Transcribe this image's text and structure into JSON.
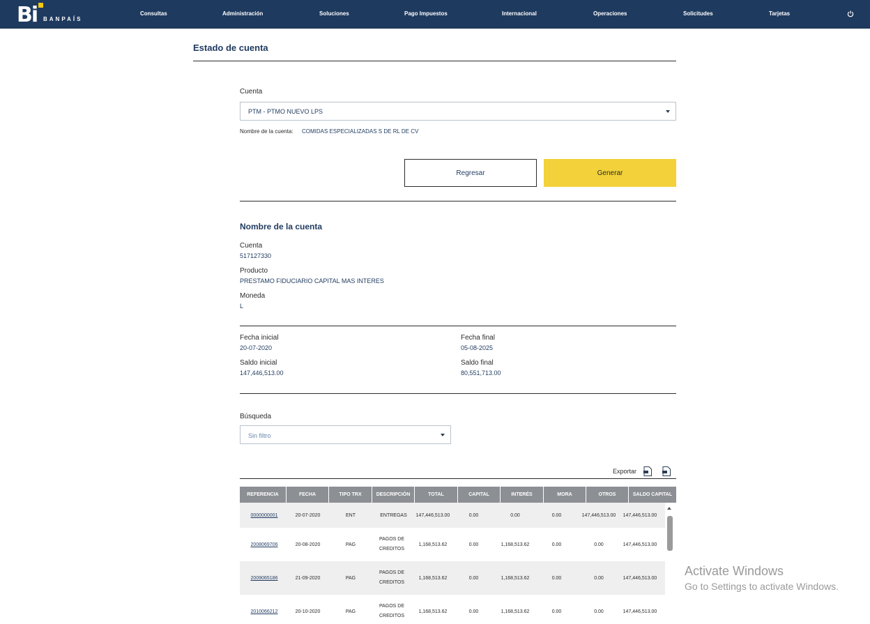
{
  "brand": {
    "logo_mark": "Bi",
    "name": "BANPAÍS"
  },
  "nav": {
    "items": [
      "Consultas",
      "Administración",
      "Soluciones",
      "Pago Impuestos",
      "Internacional",
      "Operaciones",
      "Solicitudes",
      "Tarjetas"
    ],
    "power_icon": "power-icon"
  },
  "page": {
    "title": "Estado de cuenta"
  },
  "form": {
    "cuenta_label": "Cuenta",
    "cuenta_value": "PTM - PTMO NUEVO LPS",
    "nombre_cuenta_label": "Nombre de la cuenta:",
    "nombre_cuenta_value": "COMIDAS ESPECIALIZADAS S DE RL DE CV",
    "back_label": "Regresar",
    "generate_label": "Generar"
  },
  "details": {
    "title": "Nombre de la cuenta",
    "cuenta_label": "Cuenta",
    "cuenta_value": "517127330",
    "producto_label": "Producto",
    "producto_value": "PRESTAMO FIDUCIARIO CAPITAL MAS INTERES",
    "moneda_label": "Moneda",
    "moneda_value": "L"
  },
  "period": {
    "fecha_inicial_label": "Fecha inicial",
    "fecha_inicial_value": "20-07-2020",
    "fecha_final_label": "Fecha final",
    "fecha_final_value": "05-08-2025",
    "saldo_inicial_label": "Saldo inicial",
    "saldo_inicial_value": "147,446,513.00",
    "saldo_final_label": "Saldo final",
    "saldo_final_value": "80,551,713.00"
  },
  "search": {
    "label": "Búsqueda",
    "value": "Sin filtro"
  },
  "export": {
    "label": "Exportar"
  },
  "table": {
    "headers": [
      "REFERENCIA",
      "FECHA",
      "TIPO TRX",
      "DESCRIPCIÓN",
      "TOTAL",
      "CAPITAL",
      "INTERÉS",
      "MORA",
      "OTROS",
      "SALDO CAPITAL"
    ],
    "rows": [
      [
        "0000000001",
        "20-07-2020",
        "ENT",
        "ENTREGAS",
        "147,446,513.00",
        "0.00",
        "0.00",
        "0.00",
        "147,446,513.00",
        "147,446,513.00"
      ],
      [
        "2008069706",
        "20-08-2020",
        "PAG",
        "PAGOS DE CREDITOS",
        "1,168,513.62",
        "0.00",
        "1,168,513.62",
        "0.00",
        "0.00",
        "147,446,513.00"
      ],
      [
        "2009065186",
        "21-09-2020",
        "PAG",
        "PAGOS DE CREDITOS",
        "1,168,513.62",
        "0.00",
        "1,168,513.62",
        "0.00",
        "0.00",
        "147,446,513.00"
      ],
      [
        "2010066212",
        "20-10-2020",
        "PAG",
        "PAGOS DE CREDITOS",
        "1,168,513.62",
        "0.00",
        "1,168,513.62",
        "0.00",
        "0.00",
        "147,446,513.00"
      ]
    ]
  },
  "watermark": {
    "line1": "Activate Windows",
    "line2": "Go to Settings to activate Windows."
  },
  "colors": {
    "navy": "#1f3a5f",
    "accent": "#f2d13a",
    "header_gray": "#8c8f93"
  }
}
